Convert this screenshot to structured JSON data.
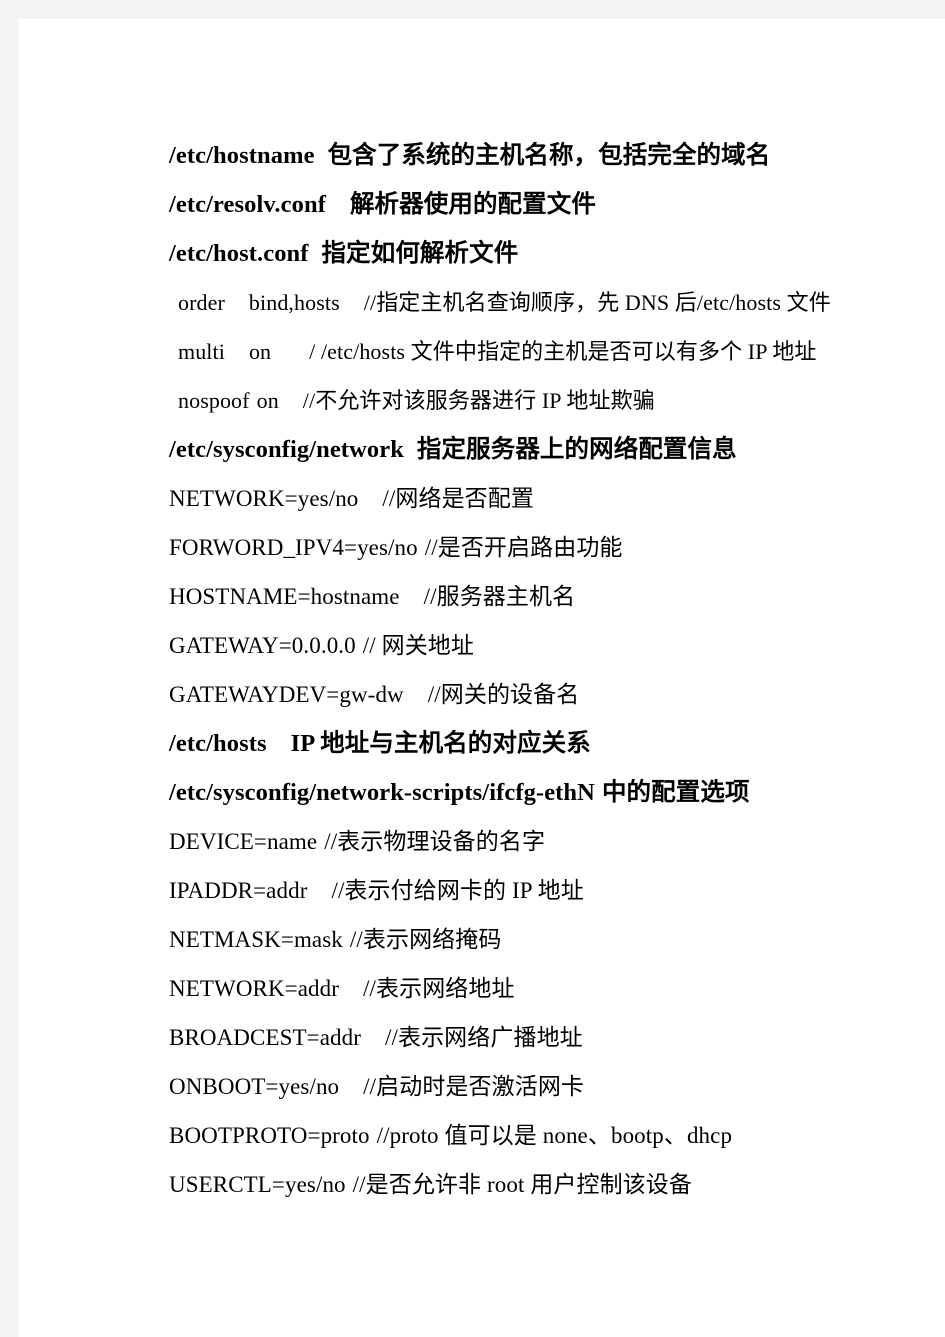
{
  "document": {
    "lines": [
      {
        "kind": "heading",
        "name": "heading-etc-hostname",
        "path": "/etc/hostname",
        "gap": "gap-s",
        "desc": "包含了系统的主机名称，包括完全的域名"
      },
      {
        "kind": "heading",
        "name": "heading-etc-resolv-conf",
        "path": "/etc/resolv.conf",
        "gap": "gap-m",
        "desc": "解析器使用的配置文件"
      },
      {
        "kind": "heading",
        "name": "heading-etc-host-conf",
        "path": "/etc/host.conf",
        "gap": "gap-s",
        "desc": "指定如何解析文件"
      },
      {
        "kind": "indent",
        "name": "option-order",
        "key": "order",
        "gap1": "gap-m",
        "value": "bind,hosts",
        "gap2": "gap-m",
        "comment": "//指定主机名查询顺序，先 DNS 后/etc/hosts 文件"
      },
      {
        "kind": "indent",
        "name": "option-multi",
        "key": "multi",
        "gap1": "gap-m",
        "value": "on",
        "gap2": "gap-l",
        "comment": "/ /etc/hosts 文件中指定的主机是否可以有多个 IP 地址"
      },
      {
        "kind": "indent",
        "name": "option-nospoof",
        "key": "nospoof",
        "gap1": "gap-xs",
        "value": "on",
        "gap2": "gap-m",
        "comment": "//不允许对该服务器进行 IP 地址欺骗"
      },
      {
        "kind": "heading",
        "name": "heading-etc-sysconfig-network",
        "path": "/etc/sysconfig/network",
        "gap": "gap-s",
        "desc": "指定服务器上的网络配置信息"
      },
      {
        "kind": "body",
        "name": "setting-network",
        "key": "NETWORK=yes/no",
        "gap1": "gap-m",
        "comment": "//网络是否配置"
      },
      {
        "kind": "body",
        "name": "setting-forword-ipv4",
        "key": "FORWORD_IPV4=yes/no",
        "gap1": "gap-xs",
        "comment": "//是否开启路由功能"
      },
      {
        "kind": "body",
        "name": "setting-hostname",
        "key": "HOSTNAME=hostname",
        "gap1": "gap-m",
        "comment": "//服务器主机名"
      },
      {
        "kind": "body",
        "name": "setting-gateway",
        "key": "GATEWAY=0.0.0.0",
        "gap1": "gap-xs",
        "comment": "// 网关地址"
      },
      {
        "kind": "body",
        "name": "setting-gatewaydev",
        "key": "GATEWAYDEV=gw-dw",
        "gap1": "gap-m",
        "comment": "//网关的设备名"
      },
      {
        "kind": "heading",
        "name": "heading-etc-hosts",
        "path": "/etc/hosts",
        "gap": "gap-m",
        "desc": "IP 地址与主机名的对应关系"
      },
      {
        "kind": "heading",
        "name": "heading-ifcfg-ethn",
        "path": "/etc/sysconfig/network-scripts/ifcfg-ethN",
        "gap": "gap-xs",
        "desc": "中的配置选项"
      },
      {
        "kind": "body",
        "name": "setting-device",
        "key": "DEVICE=name",
        "gap1": "gap-xs",
        "comment": "//表示物理设备的名字"
      },
      {
        "kind": "body",
        "name": "setting-ipaddr",
        "key": "IPADDR=addr",
        "gap1": "gap-m",
        "comment": "//表示付给网卡的 IP 地址"
      },
      {
        "kind": "body",
        "name": "setting-netmask",
        "key": "NETMASK=mask",
        "gap1": "gap-xs",
        "comment": "//表示网络掩码"
      },
      {
        "kind": "body",
        "name": "setting-network-addr",
        "key": "NETWORK=addr",
        "gap1": "gap-m",
        "comment": "//表示网络地址"
      },
      {
        "kind": "body",
        "name": "setting-broadcest",
        "key": "BROADCEST=addr",
        "gap1": "gap-m",
        "comment": "//表示网络广播地址"
      },
      {
        "kind": "body",
        "name": "setting-onboot",
        "key": "ONBOOT=yes/no",
        "gap1": "gap-m",
        "comment": "//启动时是否激活网卡"
      },
      {
        "kind": "body",
        "name": "setting-bootproto",
        "key": "BOOTPROTO=proto",
        "gap1": "gap-xs",
        "comment": "//proto 值可以是 none、bootp、dhcp"
      },
      {
        "kind": "body",
        "name": "setting-userctl",
        "key": "USERCTL=yes/no",
        "gap1": "gap-xs",
        "comment": "//是否允许非 root 用户控制该设备"
      }
    ]
  }
}
